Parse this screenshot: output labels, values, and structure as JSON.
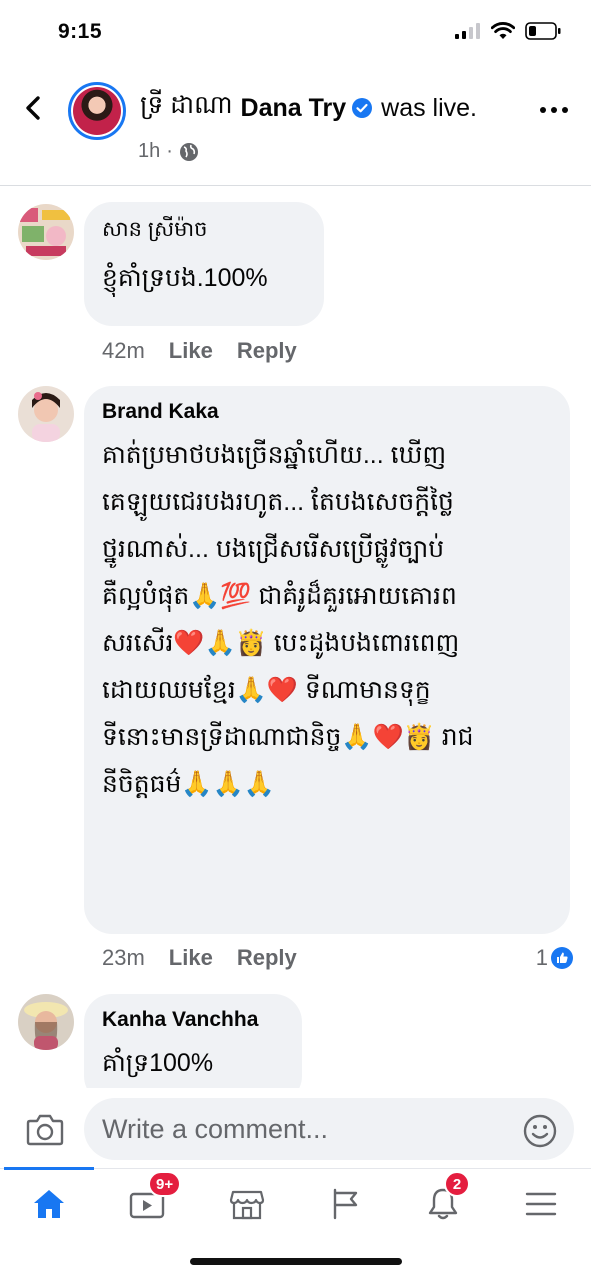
{
  "status_bar": {
    "time": "9:15"
  },
  "header": {
    "khmer_name": "ទ្រី ដាណា",
    "name": "Dana Try",
    "action": "was live.",
    "time_ago": "1h",
    "separator": "·"
  },
  "comments": [
    {
      "author": "សាន ស្រីម៉ាច",
      "text": "ខ្ញុំគាំទ្របង.100%",
      "time": "42m",
      "like_label": "Like",
      "reply_label": "Reply"
    },
    {
      "author": "Brand Kaka",
      "lines": [
        "គាត់ប្រមាថបងច្រើនឆ្នាំហើយ... ឃើញ",
        "គេឡូយជេរបងរហូត... តែបងសេចក្ដីថ្លៃ",
        "ថ្នូរណាស់... បងជ្រើសរើសប្រើផ្លូវច្បាប់",
        "គឺល្អបំផុត🙏💯 ជាគំរូដ៏គួរអោយគោរព",
        "សរសើរ❤️🙏👸 បេះដូងបងពោរពេញ",
        "ដោយឈមខ្មែរ🙏❤️ ទីណាមានទុក្ខ",
        "ទីនោះមានទ្រីដាណាជានិច្ច🙏❤️👸 រាជ",
        "នីចិត្តធម៌🙏🙏🙏"
      ],
      "time": "23m",
      "like_label": "Like",
      "reply_label": "Reply",
      "reaction_count": "1"
    },
    {
      "author": "Kanha Vanchha",
      "text": "គាំទ្រ100%"
    }
  ],
  "composer": {
    "placeholder": "Write a comment..."
  },
  "tab_bar": {
    "video_badge": "9+",
    "notifications_badge": "2"
  },
  "colors": {
    "accent": "#1877f2",
    "bubble": "#f0f2f5",
    "secondary_text": "#65676b",
    "badge": "#e41e3f"
  }
}
